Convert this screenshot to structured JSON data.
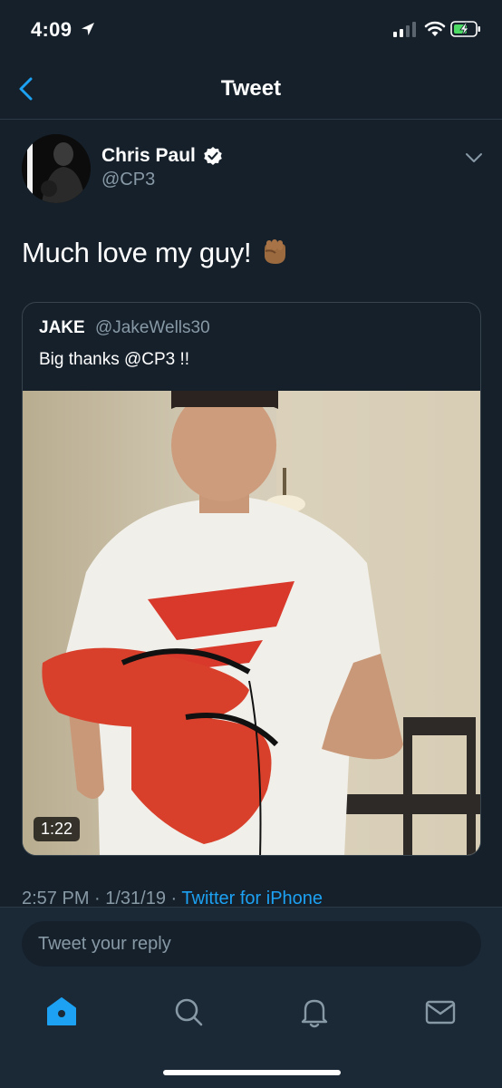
{
  "status_bar": {
    "time": "4:09",
    "icons": [
      "location-arrow-icon",
      "signal-icon",
      "wifi-icon",
      "battery-charging-icon"
    ]
  },
  "nav": {
    "title": "Tweet",
    "back_icon": "back-chevron-icon"
  },
  "tweet": {
    "author_name": "Chris Paul",
    "author_handle": "@CP3",
    "verified": true,
    "text": "Much love my guy!",
    "emoji": "raised-fist-emoji",
    "timestamp": "2:57 PM · 1/31/19 · ",
    "source": "Twitter for iPhone"
  },
  "quote": {
    "author_name": "JAKE",
    "author_handle": "@JakeWells30",
    "text": "Big thanks @CP3 !!",
    "video_duration": "1:22"
  },
  "reply": {
    "placeholder": "Tweet your reply"
  },
  "tabbar": {
    "items": [
      "home-icon",
      "search-icon",
      "notifications-bell-icon",
      "messages-envelope-icon"
    ],
    "active": "home-icon"
  },
  "colors": {
    "background": "#15202b",
    "bar": "#1b2836",
    "accent": "#1da1f2",
    "secondary_text": "#8899a6",
    "border": "#38444d"
  }
}
